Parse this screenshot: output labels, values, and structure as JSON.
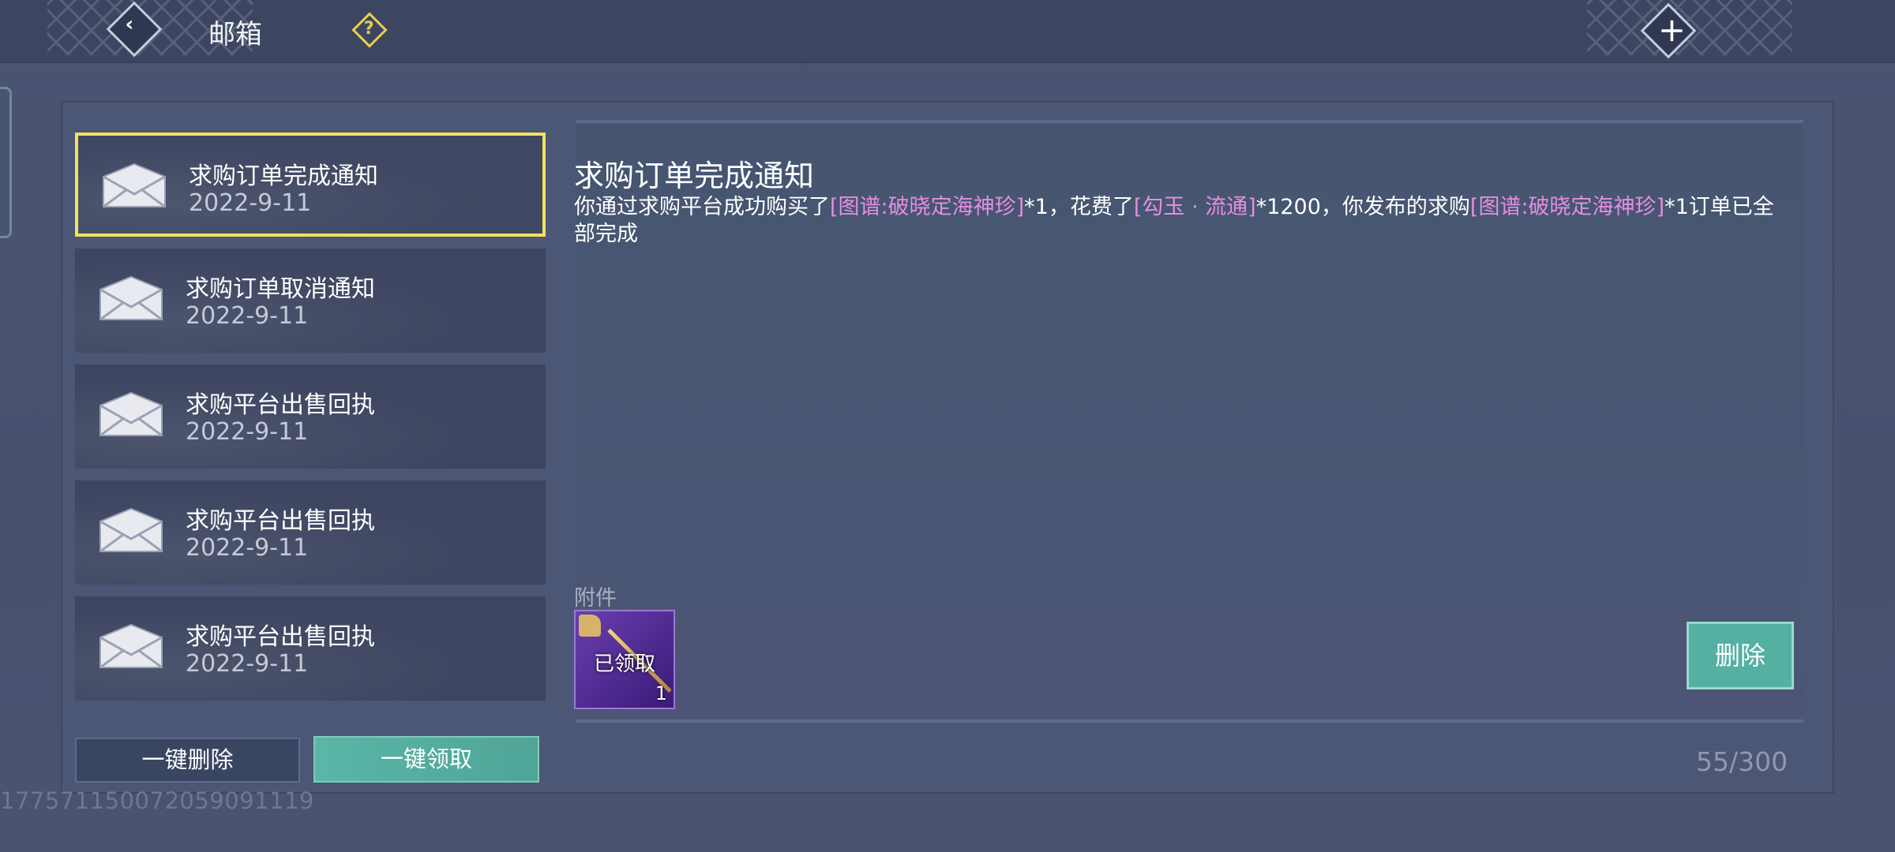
{
  "header": {
    "title": "邮箱",
    "help_icon": "?",
    "back_icon": "back-arrow-icon",
    "close_icon": "close-icon"
  },
  "mail_list": [
    {
      "title": "求购订单完成通知",
      "date": "2022-9-11",
      "selected": true
    },
    {
      "title": "求购订单取消通知",
      "date": "2022-9-11",
      "selected": false
    },
    {
      "title": "求购平台出售回执",
      "date": "2022-9-11",
      "selected": false
    },
    {
      "title": "求购平台出售回执",
      "date": "2022-9-11",
      "selected": false
    },
    {
      "title": "求购平台出售回执",
      "date": "2022-9-11",
      "selected": false
    }
  ],
  "detail": {
    "title": "求购订单完成通知",
    "body_parts": [
      "你通过求购平台成功购买了",
      "[图谱:破晓定海神珍]",
      "*1，花费了",
      "[勾玉 · 流通]",
      "*1200，你发布的求购",
      "[图谱:破晓定海神珍]",
      "*1订单已全部完成"
    ],
    "attachment_label": "附件",
    "attachment": {
      "status": "已领取",
      "quantity": "1"
    },
    "delete_label": "删除"
  },
  "footer": {
    "delete_all_label": "一键删除",
    "claim_all_label": "一键领取",
    "count": "55/300",
    "uid": "177571150072059091119"
  },
  "colors": {
    "highlight": "#e48ee0",
    "selected_border": "#f1e25a",
    "accent_button": "#55b0a2"
  }
}
